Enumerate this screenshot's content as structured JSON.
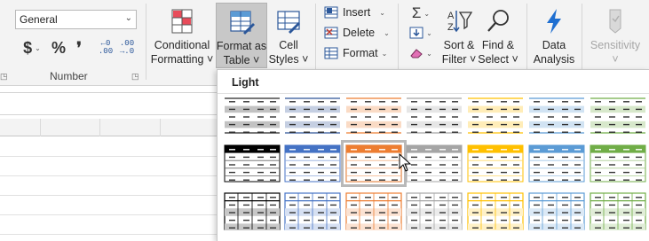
{
  "number_group": {
    "format_value": "General",
    "currency_symbol": "$",
    "percent_symbol": "%",
    "comma_symbol": "❜",
    "increase_decimal": "←0\n.00",
    "decrease_decimal": ".00\n→.0",
    "label": "Number"
  },
  "styles_group": {
    "conditional_line1": "Conditional",
    "conditional_line2": "Formatting ˅",
    "format_table_line1": "Format as",
    "format_table_line2": "Table ˅",
    "cell_styles_line1": "Cell",
    "cell_styles_line2": "Styles ˅"
  },
  "cells_group": {
    "insert": "Insert",
    "delete": "Delete",
    "format": "Format"
  },
  "editing_group": {
    "sort_line1": "Sort &",
    "sort_line2": "Filter ˅",
    "find_line1": "Find &",
    "find_line2": "Select ˅"
  },
  "analysis_group": {
    "data_line1": "Data",
    "data_line2": "Analysis"
  },
  "sensitivity_group": {
    "label": "Sensitivity",
    "chevron": "˅"
  },
  "gallery": {
    "title": "Light",
    "rows": [
      {
        "style": "banded-light",
        "colors": [
          "#262626",
          "#2f5597",
          "#ed7d31",
          "#a5a5a5",
          "#ffc000",
          "#5b9bd5",
          "#70ad47"
        ]
      },
      {
        "style": "header-filled",
        "colors": [
          "#000000",
          "#4472c4",
          "#ed7d31",
          "#a5a5a5",
          "#ffc000",
          "#5b9bd5",
          "#70ad47"
        ]
      },
      {
        "style": "grid",
        "colors": [
          "#000000",
          "#4472c4",
          "#ed7d31",
          "#a5a5a5",
          "#ffc000",
          "#5b9bd5",
          "#70ad47"
        ]
      }
    ],
    "selected": {
      "row": 1,
      "col": 2
    }
  }
}
